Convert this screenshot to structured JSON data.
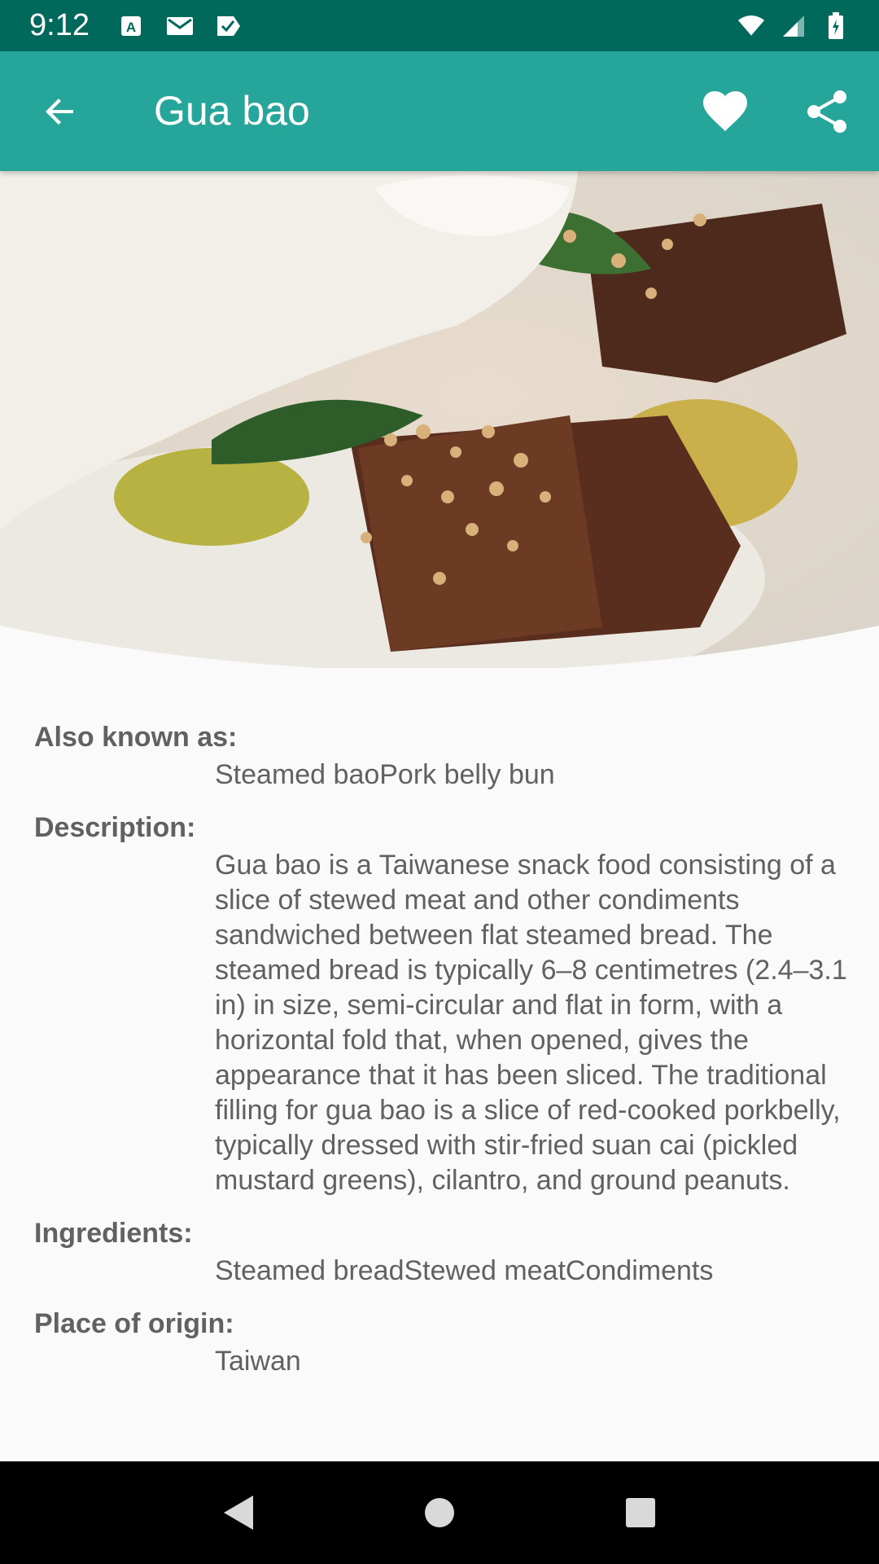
{
  "status_bar": {
    "time": "9:12",
    "left_icons": [
      "a-icon",
      "mail-icon",
      "checkbox-icon"
    ],
    "right_icons": [
      "wifi-icon",
      "signal-icon",
      "battery-icon"
    ]
  },
  "app_bar": {
    "title": "Gua bao",
    "back_icon": "arrow-back-icon",
    "favorite_icon": "heart-icon",
    "share_icon": "share-icon",
    "color": "#26a69a",
    "status_color": "#00695c"
  },
  "hero": {
    "icon": "gua-bao-photo"
  },
  "details": {
    "also_known_as": {
      "label": "Also known as:",
      "value": "Steamed baoPork belly bun"
    },
    "description": {
      "label": "Description:",
      "value": "Gua bao is a Taiwanese snack food consisting of a slice of stewed meat and other condiments sandwiched between flat steamed bread. The steamed bread is typically 6–8 centimetres (2.4–3.1 in) in size, semi-circular and flat in form, with a horizontal fold that, when opened, gives the appearance that it has been sliced. The traditional filling for gua bao is a slice of red-cooked porkbelly, typically dressed with stir-fried suan cai (pickled mustard greens), cilantro, and ground peanuts."
    },
    "ingredients": {
      "label": "Ingredients:",
      "value": "Steamed breadStewed meatCondiments"
    },
    "place_of_origin": {
      "label": "Place of origin:",
      "value": "Taiwan"
    }
  },
  "nav_bar": {
    "back_icon": "nav-back-icon",
    "home_icon": "nav-home-icon",
    "recents_icon": "nav-recents-icon"
  }
}
